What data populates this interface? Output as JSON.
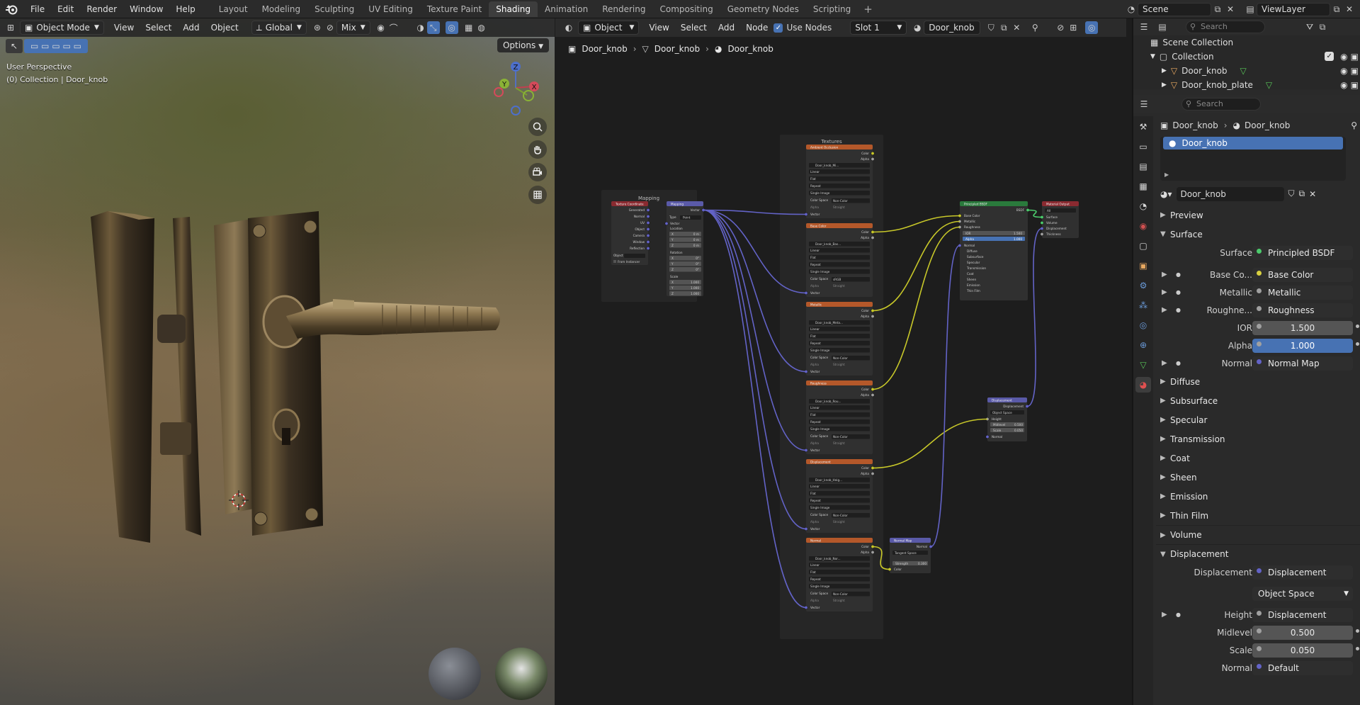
{
  "topbar": {
    "menus": [
      "File",
      "Edit",
      "Render",
      "Window",
      "Help"
    ],
    "workspaces": [
      "Layout",
      "Modeling",
      "Sculpting",
      "UV Editing",
      "Texture Paint",
      "Shading",
      "Animation",
      "Rendering",
      "Compositing",
      "Geometry Nodes",
      "Scripting"
    ],
    "active_workspace": "Shading",
    "scene": "Scene",
    "view_layer": "ViewLayer"
  },
  "viewport": {
    "mode": "Object Mode",
    "menus": [
      "View",
      "Select",
      "Add",
      "Object"
    ],
    "orientation": "Global",
    "blend": "Mix",
    "options_label": "Options",
    "info_line1": "User Perspective",
    "info_line2": "(0) Collection | Door_knob",
    "gizmo": {
      "x": "X",
      "y": "Y",
      "z": "Z"
    }
  },
  "node_editor": {
    "type": "Object",
    "menus": [
      "View",
      "Select",
      "Add",
      "Node"
    ],
    "use_nodes_label": "Use Nodes",
    "slot": "Slot 1",
    "material": "Door_knob",
    "breadcrumb": [
      "Door_knob",
      "Door_knob",
      "Door_knob"
    ],
    "frame_mapping": "Mapping",
    "frame_textures": "Textures",
    "nodes": {
      "texcoord": {
        "title": "Texture Coordinate",
        "outputs": [
          "Generated",
          "Normal",
          "UV",
          "Object",
          "Camera",
          "Window",
          "Reflection"
        ],
        "object_label": "Object",
        "from_instancer": "From Instancer"
      },
      "mapping": {
        "title": "Mapping",
        "output": "Vector",
        "type_label": "Type",
        "type_value": "Point",
        "vector": "Vector",
        "location": "Location",
        "rotation": "Rotation",
        "scale": "Scale",
        "x": "X",
        "y": "Y",
        "z": "Z",
        "loc_val": "0 m",
        "rot_val": "0°",
        "scale_val": "1.000"
      },
      "tex_labels": {
        "color": "Color",
        "alpha": "Alpha",
        "linear": "Linear",
        "flat": "Flat",
        "repeat": "Repeat",
        "single_image": "Single Image",
        "color_space": "Color Space",
        "alpha_mode": "Alpha",
        "straight": "Straight",
        "vector": "Vector",
        "non_color": "Non-Color",
        "srgb": "sRGB"
      },
      "textures": [
        {
          "title": "Ambient Occlusion",
          "image": "Door_knob_Mi..."
        },
        {
          "title": "Base Color",
          "image": "Door_knob_Bas..."
        },
        {
          "title": "Metallic",
          "image": "Door_knob_Meta..."
        },
        {
          "title": "Roughness",
          "image": "Door_knob_Rou..."
        },
        {
          "title": "Displacement",
          "image": "Door_knob_Heig..."
        },
        {
          "title": "Normal",
          "image": "Door_knob_Nor..."
        }
      ],
      "bsdf": {
        "title": "Principled BSDF",
        "output": "BSDF",
        "inputs": [
          "Base Color",
          "Metallic",
          "Roughness",
          "IOR",
          "Alpha",
          "Normal"
        ],
        "ior": "1.500",
        "alpha": "1.000",
        "panels": [
          "Diffuse",
          "Subsurface",
          "Specular",
          "Transmission",
          "Coat",
          "Sheen",
          "Emission",
          "Thin Film"
        ]
      },
      "output": {
        "title": "Material Output",
        "target": "All",
        "inputs": [
          "Surface",
          "Volume",
          "Displacement",
          "Thickness"
        ]
      },
      "displacement": {
        "title": "Displacement",
        "output": "Displacement",
        "space": "Object Space",
        "height": "Height",
        "midlevel_label": "Midlevel",
        "midlevel": "0.500",
        "scale_label": "Scale",
        "scale": "0.050",
        "normal": "Normal"
      },
      "normalmap": {
        "title": "Normal Map",
        "output": "Normal",
        "space": "Tangent Space",
        "strength_label": "Strength",
        "strength": "0.300",
        "color": "Color"
      }
    }
  },
  "outliner": {
    "search_placeholder": "Search",
    "scene_collection": "Scene Collection",
    "collection": "Collection",
    "objects": [
      "Door_knob",
      "Door_knob_plate"
    ]
  },
  "properties": {
    "search_placeholder": "Search",
    "breadcrumb_object": "Door_knob",
    "breadcrumb_material": "Door_knob",
    "slot_name": "Door_knob",
    "material_name": "Door_knob",
    "sections": {
      "preview": "Preview",
      "surface": "Surface",
      "volume": "Volume",
      "displacement": "Displacement"
    },
    "surface": {
      "label": "Surface",
      "value": "Principled BSDF"
    },
    "inputs": [
      {
        "label": "Base Co...",
        "value": "Base Color"
      },
      {
        "label": "Metallic",
        "value": "Metallic"
      },
      {
        "label": "Roughne...",
        "value": "Roughness"
      }
    ],
    "ior": {
      "label": "IOR",
      "value": "1.500"
    },
    "alpha": {
      "label": "Alpha",
      "value": "1.000"
    },
    "normal": {
      "label": "Normal",
      "value": "Normal Map"
    },
    "subpanels": [
      "Diffuse",
      "Subsurface",
      "Specular",
      "Transmission",
      "Coat",
      "Sheen",
      "Emission",
      "Thin Film"
    ],
    "disp": {
      "label": "Displacement",
      "value": "Displacement",
      "space": "Object Space"
    },
    "height": {
      "label": "Height",
      "value": "Displacement"
    },
    "midlevel": {
      "label": "Midlevel",
      "value": "0.500"
    },
    "scale": {
      "label": "Scale",
      "value": "0.050"
    },
    "disp_normal": {
      "label": "Normal",
      "value": "Default"
    }
  },
  "colors": {
    "accent": "#4772b3",
    "tex_header": "#b4582a",
    "vector_header": "#5a5aa8",
    "shader_header": "#2a7a3c",
    "output_header": "#8a2a30",
    "link_yellow": "#c7c729",
    "link_purple": "#6363c7"
  }
}
